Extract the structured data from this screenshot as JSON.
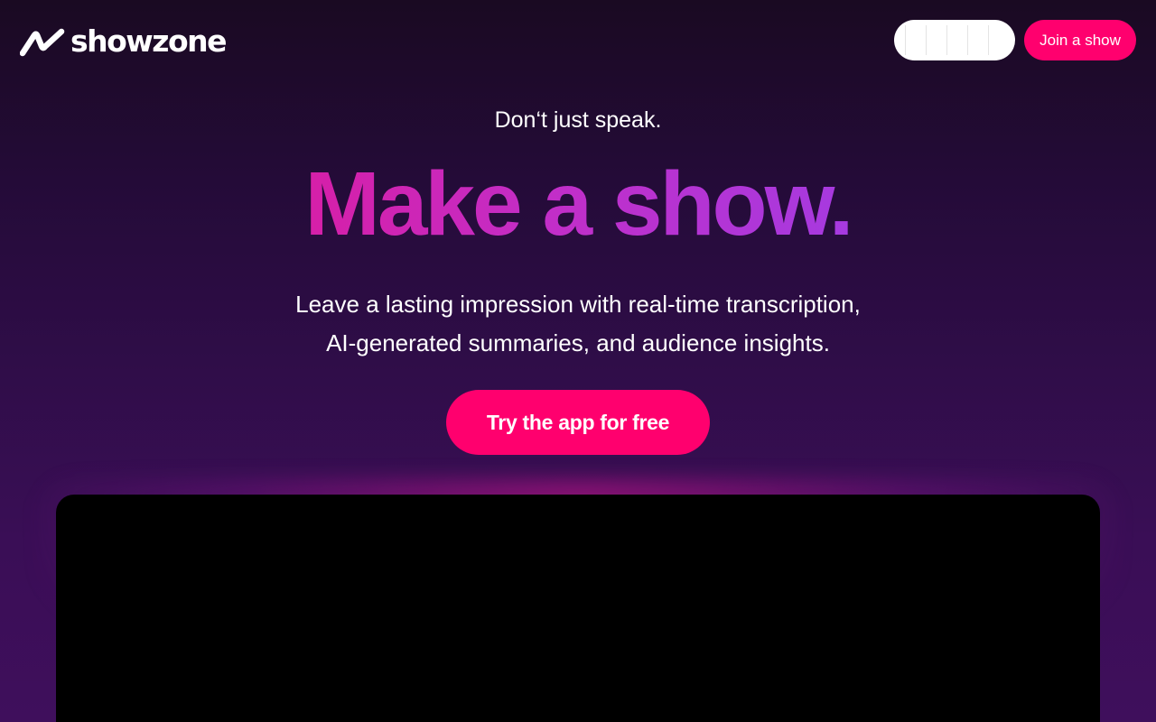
{
  "header": {
    "logo_text": "showzone",
    "join_label": "Join a show"
  },
  "hero": {
    "kicker": "Don‘t just speak.",
    "headline": "Make a show.",
    "subtitle_line1": "Leave a lasting impression with real-time transcription,",
    "subtitle_line2": "AI-generated summaries, and audience insights.",
    "cta_label": "Try the app for free"
  },
  "colors": {
    "accent": "#ff006e",
    "headline_gradient_start": "#d61fa8",
    "headline_gradient_end": "#a63ae0",
    "background_top": "#1a0a22",
    "background_bottom": "#3f0f5c"
  },
  "icons": {
    "logo": "wave-squiggle-icon"
  }
}
